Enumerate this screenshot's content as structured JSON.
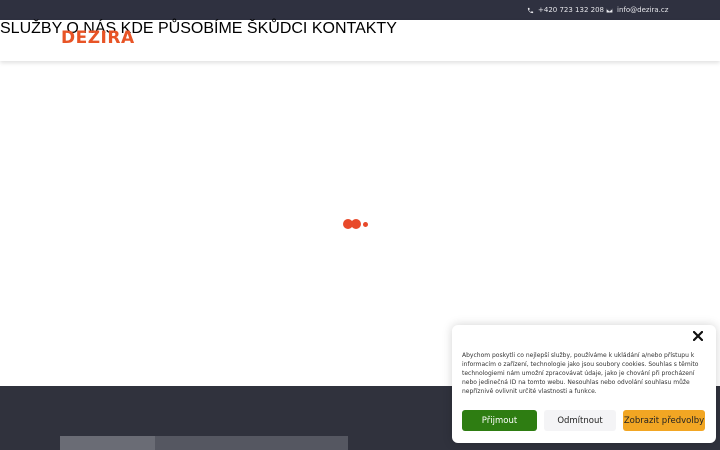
{
  "topbar": {
    "phone": "+420 723 132 208",
    "email": "info@dezira.cz",
    "phone_icon": "phone-icon",
    "email_icon": "envelope-icon"
  },
  "header": {
    "logo": "DEZIRA",
    "brand_color": "#e85426",
    "nav": [
      {
        "label": "SLUŽBY"
      },
      {
        "label": "O NÁS"
      },
      {
        "label": "KDE PŮSOBÍME"
      },
      {
        "label": "ŠKŮDCI"
      },
      {
        "label": "KONTAKTY"
      }
    ]
  },
  "loader": {
    "icon": "loading-dots-icon",
    "color": "#e8492a"
  },
  "cookie": {
    "text": "Abychom poskytli co nejlepší služby, používáme k ukládání a/nebo přístupu k informacím o zařízení, technologie jako jsou soubory cookies. Souhlas s těmito technologiemi nám umožní zpracovávat údaje, jako je chování při procházení nebo jedinečná ID na tomto webu. Nesouhlas nebo odvolání souhlasu může nepříznivě ovlivnit určité vlastnosti a funkce.",
    "accept": "Přijmout",
    "deny": "Odmítnout",
    "preferences": "Zobrazit předvolby",
    "close_icon": "close-icon",
    "accept_color": "#2e7d12",
    "preferences_color": "#f2a623"
  }
}
